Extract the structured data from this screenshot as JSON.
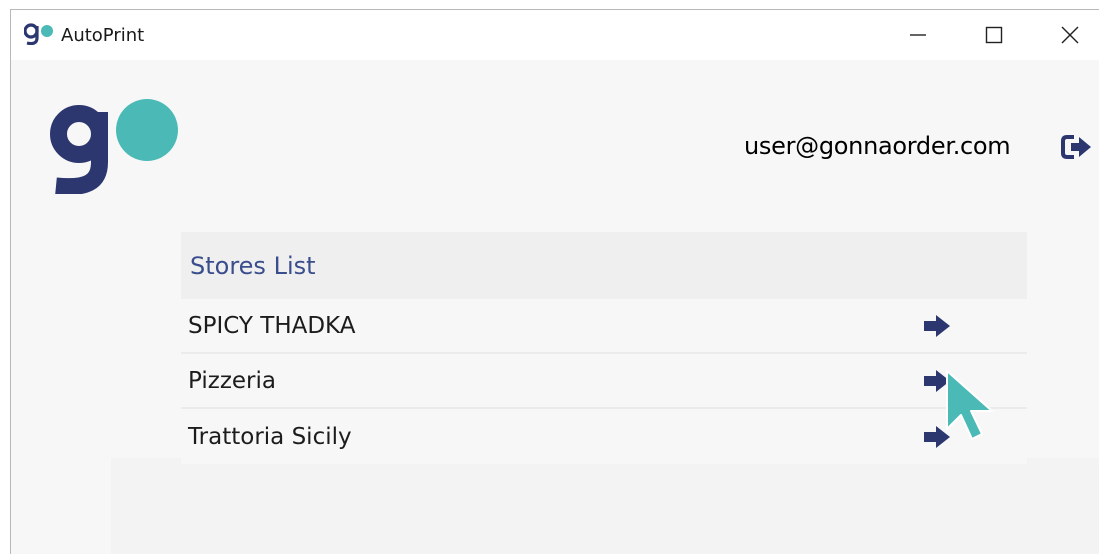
{
  "window": {
    "title": "AutoPrint",
    "minimize_icon": "minimize-icon",
    "maximize_icon": "maximize-icon",
    "close_icon": "close-icon"
  },
  "header": {
    "logo": "go-logo",
    "user_email": "user@gonnaorder.com",
    "logout_icon": "logout-icon"
  },
  "stores": {
    "heading": "Stores List",
    "items": [
      {
        "name": "SPICY THADKA",
        "icon": "arrow-right-icon"
      },
      {
        "name": "Pizzeria",
        "icon": "arrow-right-icon"
      },
      {
        "name": "Trattoria Sicily",
        "icon": "arrow-right-icon"
      }
    ]
  },
  "colors": {
    "brand_navy": "#2c3770",
    "brand_teal": "#4bbab7",
    "heading_text": "#3a4d8c"
  }
}
